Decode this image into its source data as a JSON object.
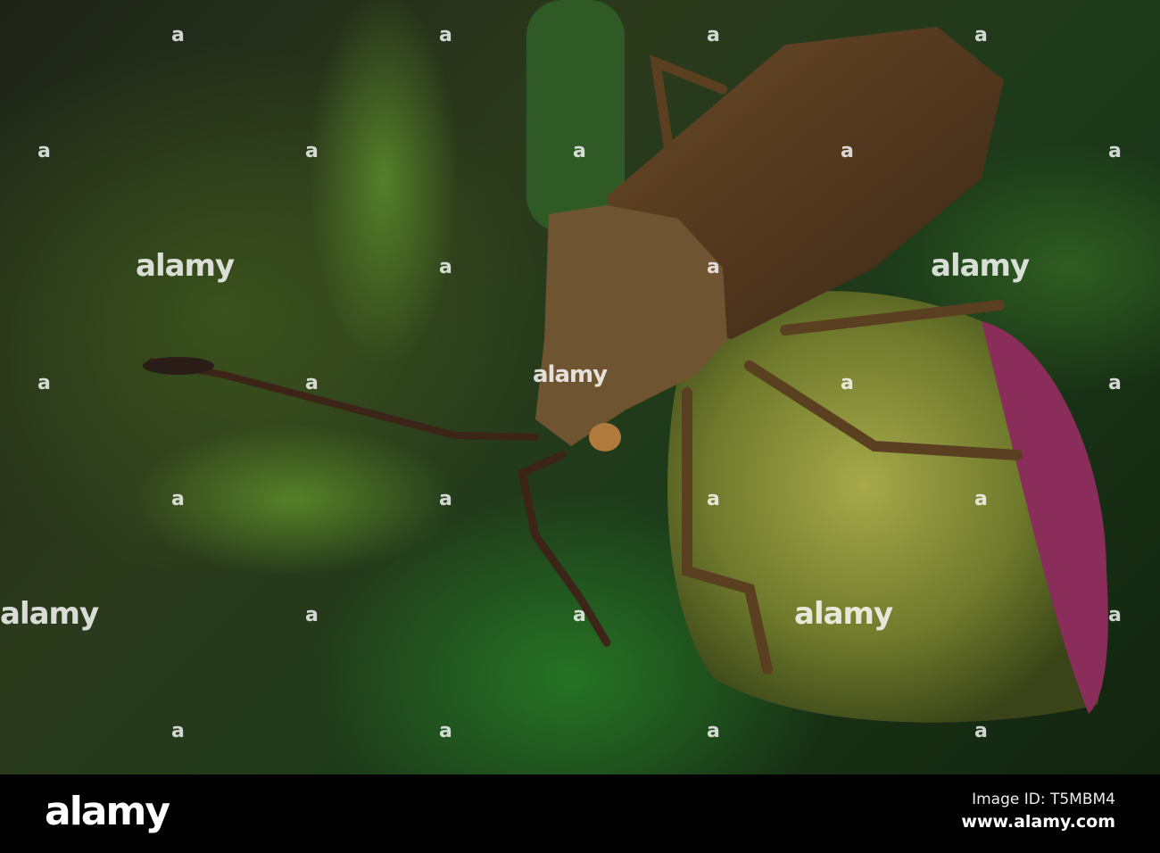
{
  "watermark": {
    "text": "alamy",
    "mark": "a"
  },
  "footer": {
    "logo": "alamy",
    "image_id": "Image ID: T5MBM4",
    "url": "www.alamy.com"
  }
}
